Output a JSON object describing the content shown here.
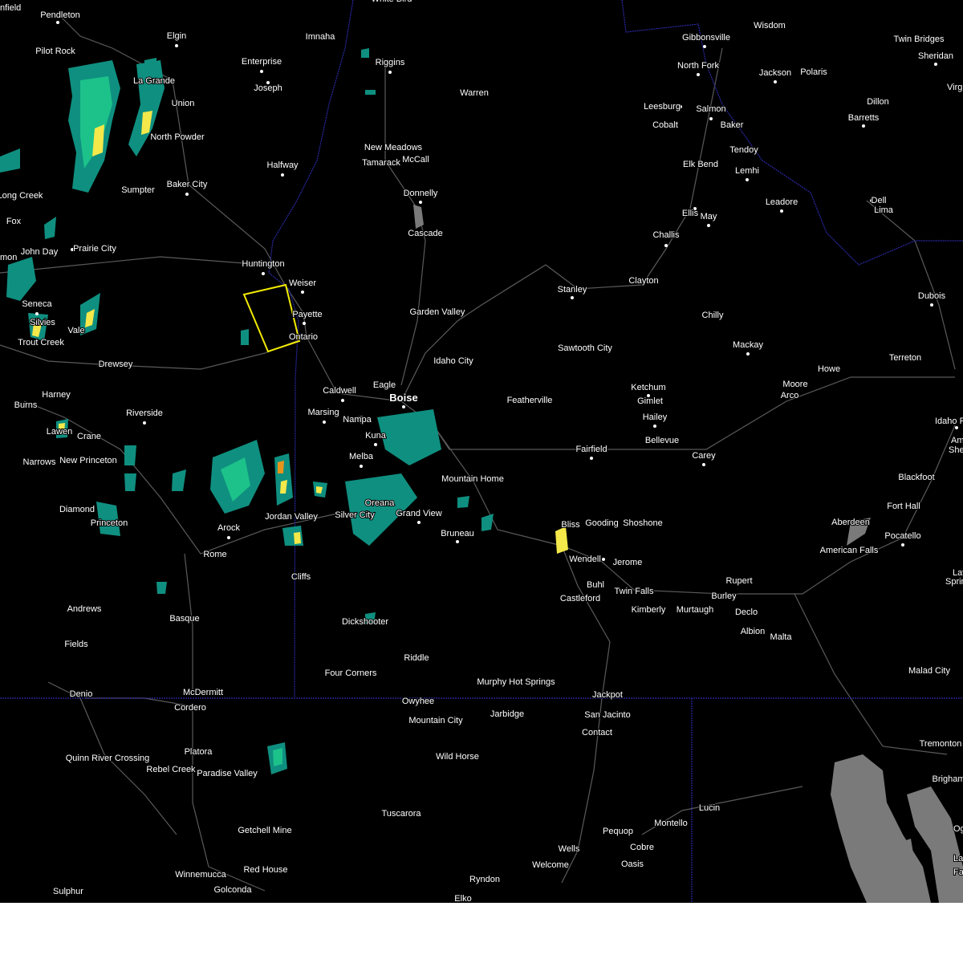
{
  "map": {
    "colors": {
      "background": "#000000",
      "roads": "#5a5a5a",
      "state_border": "#2a2aa8",
      "water": "#7a7a7a",
      "warning_polygon": "#f2ea00",
      "radar_light": "#0f8f80",
      "radar_mid": "#1cc28a",
      "radar_yellow": "#f4e84a",
      "radar_orange": "#e8941a"
    },
    "places": [
      {
        "name": "nfield"
      },
      {
        "name": "Pendleton"
      },
      {
        "name": "White Bird"
      },
      {
        "name": "Wisdom"
      },
      {
        "name": "Gibbonsville"
      },
      {
        "name": "Twin Bridges"
      },
      {
        "name": "Sheridan"
      },
      {
        "name": "Virg"
      },
      {
        "name": "Elgin"
      },
      {
        "name": "Imnaha"
      },
      {
        "name": "Pilot Rock"
      },
      {
        "name": "Enterprise"
      },
      {
        "name": "Riggins"
      },
      {
        "name": "North Fork"
      },
      {
        "name": "Jackson"
      },
      {
        "name": "Polaris"
      },
      {
        "name": "La Grande"
      },
      {
        "name": "Joseph"
      },
      {
        "name": "Warren"
      },
      {
        "name": "Union"
      },
      {
        "name": "Leesburg"
      },
      {
        "name": "Salmon"
      },
      {
        "name": "Dillon"
      },
      {
        "name": "Cobalt"
      },
      {
        "name": "Baker"
      },
      {
        "name": "Barretts"
      },
      {
        "name": "North Powder"
      },
      {
        "name": "New Meadows"
      },
      {
        "name": "Tendoy"
      },
      {
        "name": "McCall"
      },
      {
        "name": "Tamarack"
      },
      {
        "name": "Halfway"
      },
      {
        "name": "Elk Bend"
      },
      {
        "name": "Lemhi"
      },
      {
        "name": "Sumpter"
      },
      {
        "name": "Baker City"
      },
      {
        "name": "Donnelly"
      },
      {
        "name": "Long Creek"
      },
      {
        "name": "Dell"
      },
      {
        "name": "Leadore"
      },
      {
        "name": "Lima"
      },
      {
        "name": "Ellis"
      },
      {
        "name": "May"
      },
      {
        "name": "Fox"
      },
      {
        "name": "Cascade"
      },
      {
        "name": "Challis"
      },
      {
        "name": "Prairie City"
      },
      {
        "name": "John Day"
      },
      {
        "name": "mon"
      },
      {
        "name": "Huntington"
      },
      {
        "name": "Clayton"
      },
      {
        "name": "Weiser"
      },
      {
        "name": "Stanley"
      },
      {
        "name": "Dubois"
      },
      {
        "name": "Seneca"
      },
      {
        "name": "Garden Valley"
      },
      {
        "name": "Payette"
      },
      {
        "name": "Chilly"
      },
      {
        "name": "Silvies"
      },
      {
        "name": "Vale"
      },
      {
        "name": "Ontario"
      },
      {
        "name": "Trout Creek"
      },
      {
        "name": "Mackay"
      },
      {
        "name": "Sawtooth City"
      },
      {
        "name": "Terreton"
      },
      {
        "name": "Idaho City"
      },
      {
        "name": "Drewsey"
      },
      {
        "name": "Howe"
      },
      {
        "name": "Moore"
      },
      {
        "name": "Ketchum"
      },
      {
        "name": "Eagle"
      },
      {
        "name": "Caldwell"
      },
      {
        "name": "Arco"
      },
      {
        "name": "Harney"
      },
      {
        "name": "Boise"
      },
      {
        "name": "Featherville"
      },
      {
        "name": "Gimlet"
      },
      {
        "name": "Burns"
      },
      {
        "name": "Riverside"
      },
      {
        "name": "Marsing"
      },
      {
        "name": "Hailey"
      },
      {
        "name": "Idaho Fa"
      },
      {
        "name": "Nampa"
      },
      {
        "name": "Lawen"
      },
      {
        "name": "Kuna"
      },
      {
        "name": "Bellevue"
      },
      {
        "name": "Crane"
      },
      {
        "name": "Am"
      },
      {
        "name": "She"
      },
      {
        "name": "Fairfield"
      },
      {
        "name": "Melba"
      },
      {
        "name": "Carey"
      },
      {
        "name": "Narrows"
      },
      {
        "name": "New Princeton"
      },
      {
        "name": "Mountain Home"
      },
      {
        "name": "Blackfoot"
      },
      {
        "name": "Oreana"
      },
      {
        "name": "Fort Hall"
      },
      {
        "name": "Diamond"
      },
      {
        "name": "Jordan Valley"
      },
      {
        "name": "Silver City"
      },
      {
        "name": "Grand View"
      },
      {
        "name": "Aberdeen"
      },
      {
        "name": "Princeton"
      },
      {
        "name": "Bliss"
      },
      {
        "name": "Gooding"
      },
      {
        "name": "Shoshone"
      },
      {
        "name": "Pocatello"
      },
      {
        "name": "Arock"
      },
      {
        "name": "Bruneau"
      },
      {
        "name": "American Falls"
      },
      {
        "name": "Rome"
      },
      {
        "name": "Wendell"
      },
      {
        "name": "Jerome"
      },
      {
        "name": "Lava"
      },
      {
        "name": "Sprin"
      },
      {
        "name": "Cliffs"
      },
      {
        "name": "Rupert"
      },
      {
        "name": "Buhl"
      },
      {
        "name": "Twin Falls"
      },
      {
        "name": "Burley"
      },
      {
        "name": "Castleford"
      },
      {
        "name": "Andrews"
      },
      {
        "name": "Kimberly"
      },
      {
        "name": "Murtaugh"
      },
      {
        "name": "Declo"
      },
      {
        "name": "Basque"
      },
      {
        "name": "Dickshooter"
      },
      {
        "name": "Albion"
      },
      {
        "name": "Malta"
      },
      {
        "name": "Fields"
      },
      {
        "name": "Riddle"
      },
      {
        "name": "Four Corners"
      },
      {
        "name": "Malad City"
      },
      {
        "name": "Murphy Hot Springs"
      },
      {
        "name": "McDermitt"
      },
      {
        "name": "Denio"
      },
      {
        "name": "Jackpot"
      },
      {
        "name": "Owyhee"
      },
      {
        "name": "Cordero"
      },
      {
        "name": "Jarbidge"
      },
      {
        "name": "San Jacinto"
      },
      {
        "name": "Mountain City"
      },
      {
        "name": "Contact"
      },
      {
        "name": "Tremonton"
      },
      {
        "name": "Platora"
      },
      {
        "name": "Wild Horse"
      },
      {
        "name": "Quinn River Crossing"
      },
      {
        "name": "Brigham"
      },
      {
        "name": "Rebel Creek"
      },
      {
        "name": "Paradise Valley"
      },
      {
        "name": "Tuscarora"
      },
      {
        "name": "Lucin"
      },
      {
        "name": "Montello"
      },
      {
        "name": "Og"
      },
      {
        "name": "Pequop"
      },
      {
        "name": "Getchell Mine"
      },
      {
        "name": "Cobre"
      },
      {
        "name": "Wells"
      },
      {
        "name": "La"
      },
      {
        "name": "Welcome"
      },
      {
        "name": "Red House"
      },
      {
        "name": "Winnemucca"
      },
      {
        "name": "Oasis"
      },
      {
        "name": "Fa"
      },
      {
        "name": "Sulphur"
      },
      {
        "name": "Golconda"
      },
      {
        "name": "Ryndon"
      },
      {
        "name": "Elko"
      }
    ]
  }
}
